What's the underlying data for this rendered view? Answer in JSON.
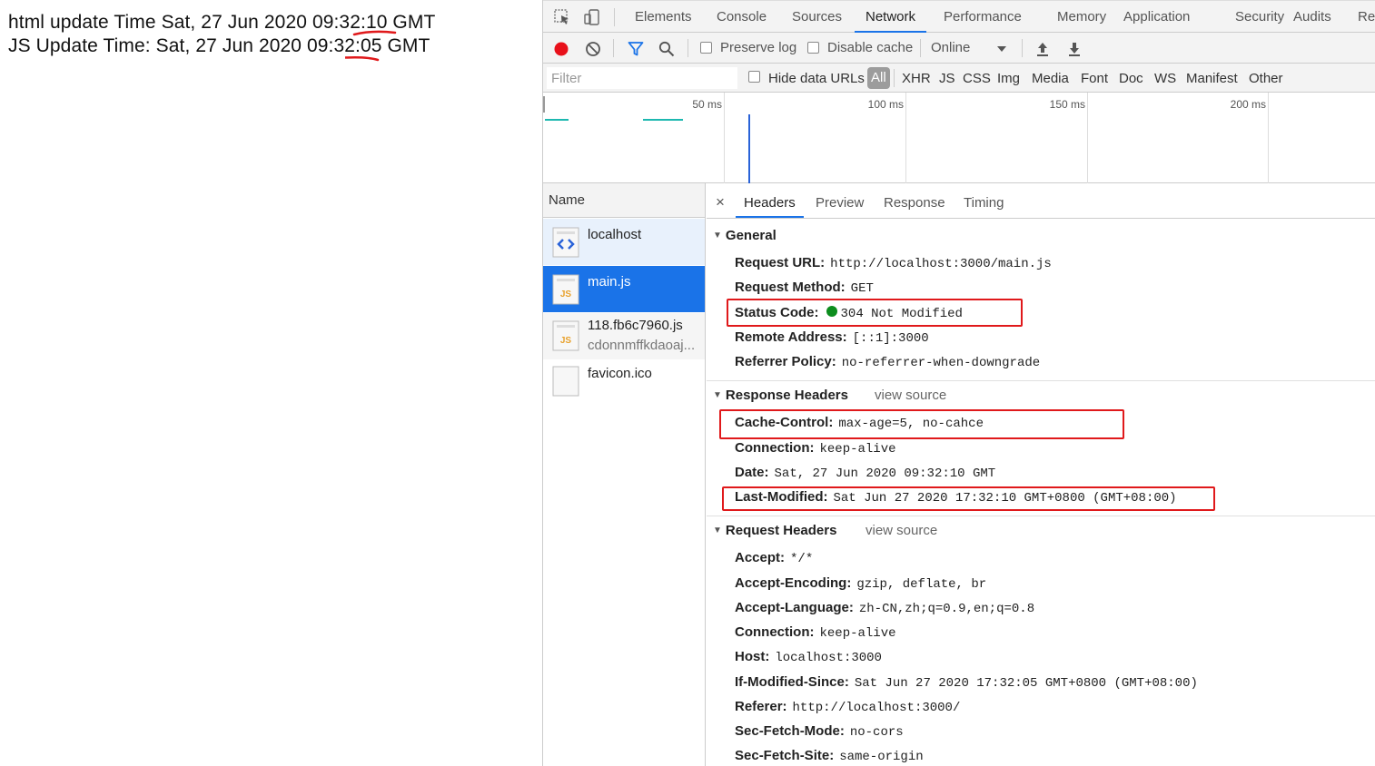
{
  "page": {
    "line1": {
      "prefix": "html update Time Sat, 27 Jun 2020 09:32",
      "colon": ":",
      "seconds": "10",
      "suffix": " GMT"
    },
    "line2": {
      "prefix": "JS Update Time: Sat, 27 Jun 2020 09:",
      "minsec": "32:05",
      "suffix": " GMT"
    }
  },
  "devtools": {
    "main_tabs": [
      "Elements",
      "Console",
      "Sources",
      "Network",
      "Performance",
      "Memory",
      "Application",
      "Security",
      "Audits",
      "Rec"
    ],
    "active_tab": "Network",
    "toolbar": {
      "preserve_log": "Preserve log",
      "disable_cache": "Disable cache",
      "throttle": "Online"
    },
    "filter": {
      "placeholder": "Filter",
      "hide_data_urls": "Hide data URLs",
      "types": [
        "All",
        "XHR",
        "JS",
        "CSS",
        "Img",
        "Media",
        "Font",
        "Doc",
        "WS",
        "Manifest",
        "Other"
      ]
    },
    "overview": {
      "ticks": [
        "50 ms",
        "100 ms",
        "150 ms",
        "200 ms"
      ]
    },
    "requests": {
      "header": "Name",
      "items": [
        {
          "name": "localhost",
          "sub": "",
          "icon": "html-file-icon"
        },
        {
          "name": "main.js",
          "sub": "",
          "icon": "js-file-icon",
          "selected": true
        },
        {
          "name": "118.fb6c7960.js",
          "sub": "cdonnmffkdaoaj...",
          "icon": "js-file-icon"
        },
        {
          "name": "favicon.ico",
          "sub": "",
          "icon": "blank-file-icon"
        }
      ]
    },
    "detail": {
      "close": "×",
      "tabs": [
        "Headers",
        "Preview",
        "Response",
        "Timing"
      ],
      "active_tab": "Headers",
      "general": {
        "title": "General",
        "rows": [
          {
            "k": "Request URL:",
            "v": "http://localhost:3000/main.js"
          },
          {
            "k": "Request Method:",
            "v": "GET"
          },
          {
            "k": "Status Code:",
            "v": "304 Not Modified"
          },
          {
            "k": "Remote Address:",
            "v": "[::1]:3000"
          },
          {
            "k": "Referrer Policy:",
            "v": "no-referrer-when-downgrade"
          }
        ]
      },
      "response_headers": {
        "title": "Response Headers",
        "view_source": "view source",
        "rows": [
          {
            "k": "Cache-Control:",
            "v": "max-age=5, no-cahce"
          },
          {
            "k": "Connection:",
            "v": "keep-alive"
          },
          {
            "k": "Date:",
            "v": "Sat, 27 Jun 2020 09:32:10 GMT"
          },
          {
            "k": "Last-Modified:",
            "v": "Sat Jun 27 2020 17:32:10 GMT+0800 (GMT+08:00)"
          }
        ]
      },
      "request_headers": {
        "title": "Request Headers",
        "view_source": "view source",
        "rows": [
          {
            "k": "Accept:",
            "v": "*/*"
          },
          {
            "k": "Accept-Encoding:",
            "v": "gzip, deflate, br"
          },
          {
            "k": "Accept-Language:",
            "v": "zh-CN,zh;q=0.9,en;q=0.8"
          },
          {
            "k": "Connection:",
            "v": "keep-alive"
          },
          {
            "k": "Host:",
            "v": "localhost:3000"
          },
          {
            "k": "If-Modified-Since:",
            "v": "Sat Jun 27 2020 17:32:05 GMT+0800 (GMT+08:00)"
          },
          {
            "k": "Referer:",
            "v": "http://localhost:3000/"
          },
          {
            "k": "Sec-Fetch-Mode:",
            "v": "no-cors"
          },
          {
            "k": "Sec-Fetch-Site:",
            "v": "same-origin"
          }
        ]
      }
    }
  },
  "colors": {
    "accent": "#1a73e8",
    "selected_row": "#1a73e8",
    "annotation_red": "#e0191b",
    "status_green": "#0c8d1e"
  }
}
